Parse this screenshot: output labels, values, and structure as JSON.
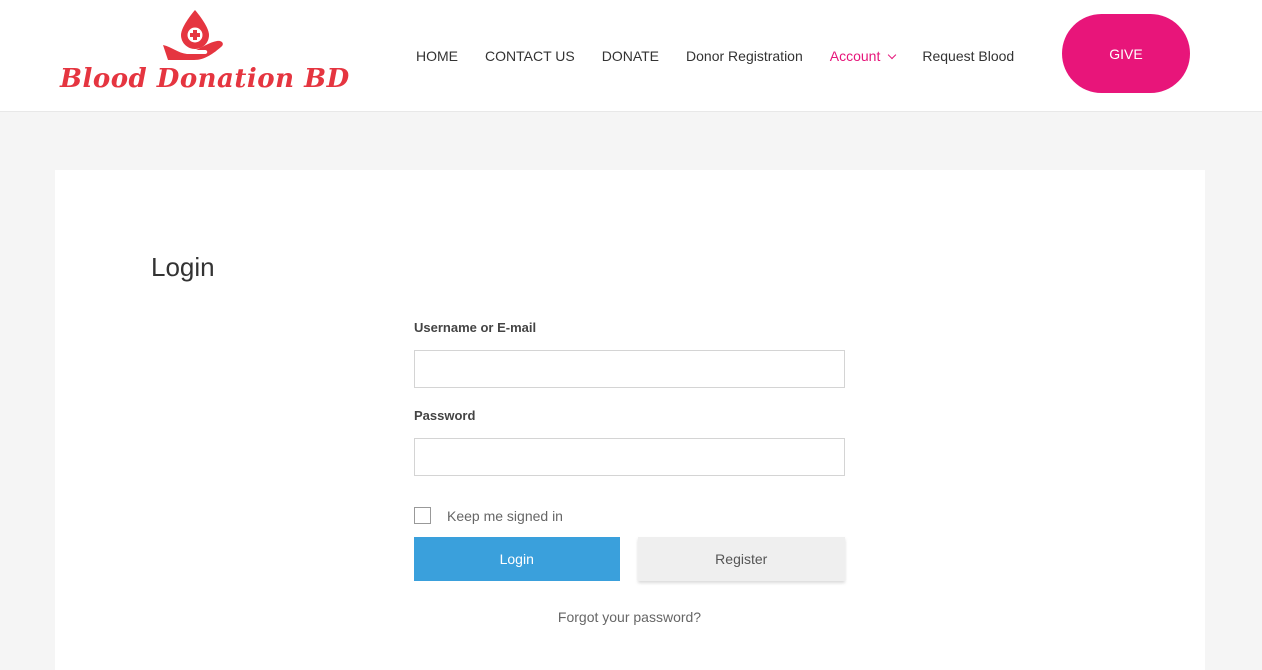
{
  "brand": {
    "name": "Blood Donation BD",
    "accent_color": "#e8157a",
    "logo_color": "#e53540",
    "icon": "blood-drop-hand-icon"
  },
  "nav": {
    "items": [
      {
        "label": "HOME",
        "active": false
      },
      {
        "label": "CONTACT US",
        "active": false
      },
      {
        "label": "DONATE",
        "active": false
      },
      {
        "label": "Donor Registration",
        "active": false
      },
      {
        "label": "Account",
        "active": true,
        "has_dropdown": true
      },
      {
        "label": "Request Blood",
        "active": false
      }
    ],
    "cta_label": "GIVE"
  },
  "login": {
    "title": "Login",
    "username_label": "Username or E-mail",
    "username_value": "",
    "password_label": "Password",
    "password_value": "",
    "remember_label": "Keep me signed in",
    "remember_checked": false,
    "login_button": "Login",
    "register_button": "Register",
    "forgot_link": "Forgot your password?",
    "login_button_color": "#3aa0dc"
  }
}
